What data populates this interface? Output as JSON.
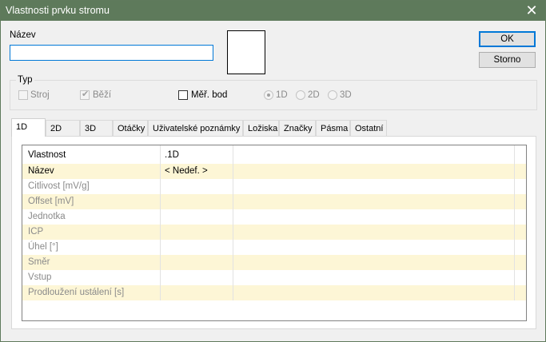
{
  "window": {
    "title": "Vlastnosti prvku stromu"
  },
  "name_field": {
    "label": "Název",
    "value": ""
  },
  "buttons": {
    "ok": "OK",
    "cancel": "Storno"
  },
  "type_group": {
    "title": "Typ",
    "machine": {
      "label": "Stroj",
      "checked": false,
      "enabled": false
    },
    "running": {
      "label": "Běží",
      "checked": true,
      "enabled": false
    },
    "measure_point": {
      "label": "Měř. bod",
      "checked": false,
      "enabled": true
    },
    "dims": [
      {
        "label": "1D",
        "selected": true
      },
      {
        "label": "2D",
        "selected": false
      },
      {
        "label": "3D",
        "selected": false
      }
    ]
  },
  "tabs": [
    "1D",
    "2D",
    "3D",
    "Otáčky",
    "Uživatelské poznámky",
    "Ložiska",
    "Značky",
    "Pásma",
    "Ostatní"
  ],
  "active_tab": "1D",
  "grid": {
    "headers": [
      "Vlastnost",
      ".1D"
    ],
    "rows": [
      {
        "property": "Název",
        "value": "< Nedef. >",
        "enabled": true
      },
      {
        "property": "Citlivost [mV/g]",
        "value": "",
        "enabled": false
      },
      {
        "property": "Offset [mV]",
        "value": "",
        "enabled": false
      },
      {
        "property": "Jednotka",
        "value": "",
        "enabled": false
      },
      {
        "property": "ICP",
        "value": "",
        "enabled": false
      },
      {
        "property": "Úhel [°]",
        "value": "",
        "enabled": false
      },
      {
        "property": "Směr",
        "value": "",
        "enabled": false
      },
      {
        "property": "Vstup",
        "value": "",
        "enabled": false
      },
      {
        "property": "Prodloužení ustálení [s]",
        "value": "",
        "enabled": false
      }
    ]
  },
  "colors": {
    "titlebar": "#5e7a5b",
    "row_highlight": "#fdf6d6",
    "focus": "#0078d7"
  }
}
